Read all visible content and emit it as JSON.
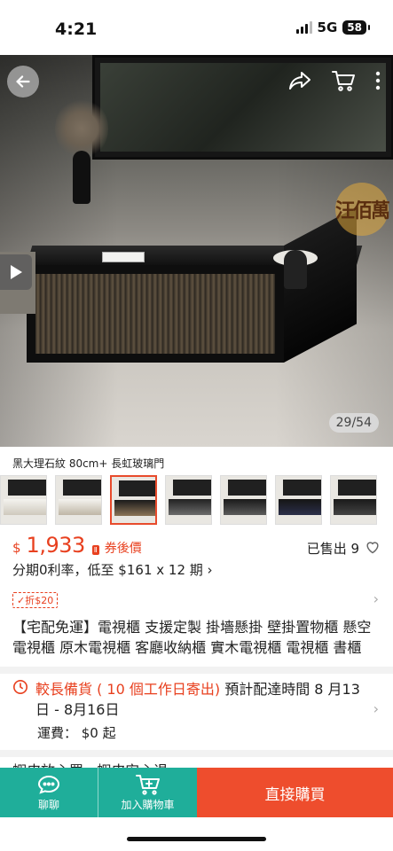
{
  "status_bar": {
    "time": "4:21",
    "network": "5G",
    "battery": "58"
  },
  "hero": {
    "counter": "29/54",
    "watermark": "汪佰萬"
  },
  "variant": {
    "label": "黑大理石紋 80cm+ 長虹玻璃門",
    "thumbnails": [
      {
        "theme": "white"
      },
      {
        "theme": "white"
      },
      {
        "theme": "black-gold",
        "selected": true
      },
      {
        "theme": "black"
      },
      {
        "theme": "black"
      },
      {
        "theme": "black-blue"
      },
      {
        "theme": "black"
      }
    ]
  },
  "price": {
    "currency": "$",
    "amount": "1,933",
    "coupon_label": "券後價",
    "coupon_icon_text": "Ⅱ",
    "sold": "已售出 9",
    "installment": "分期0利率，低至 $161 x 12 期 ›"
  },
  "discount_tag": "✓折$20",
  "title": "【宅配免運】電視櫃 支援定製 掛墻懸掛 壁掛置物櫃 懸空電視櫃 原木電視櫃 客廳收納櫃 實木電視櫃 電視櫃 書櫃",
  "shipping": {
    "highlight": "較長備貨 ( 10 個工作日寄出)",
    "estimate": " 預計配達時間 8 月13日 - 8月16日",
    "fee": "運費： $0 起"
  },
  "partial_row": "蝦皮放心買  ·  蝦皮安心退",
  "bottom_bar": {
    "chat": "聊聊",
    "add_to_cart": "加入購物車",
    "buy_now": "直接購買"
  },
  "colors": {
    "accent": "#ee4d2d",
    "price": "#e8401f",
    "teal": "#1fae9a"
  }
}
